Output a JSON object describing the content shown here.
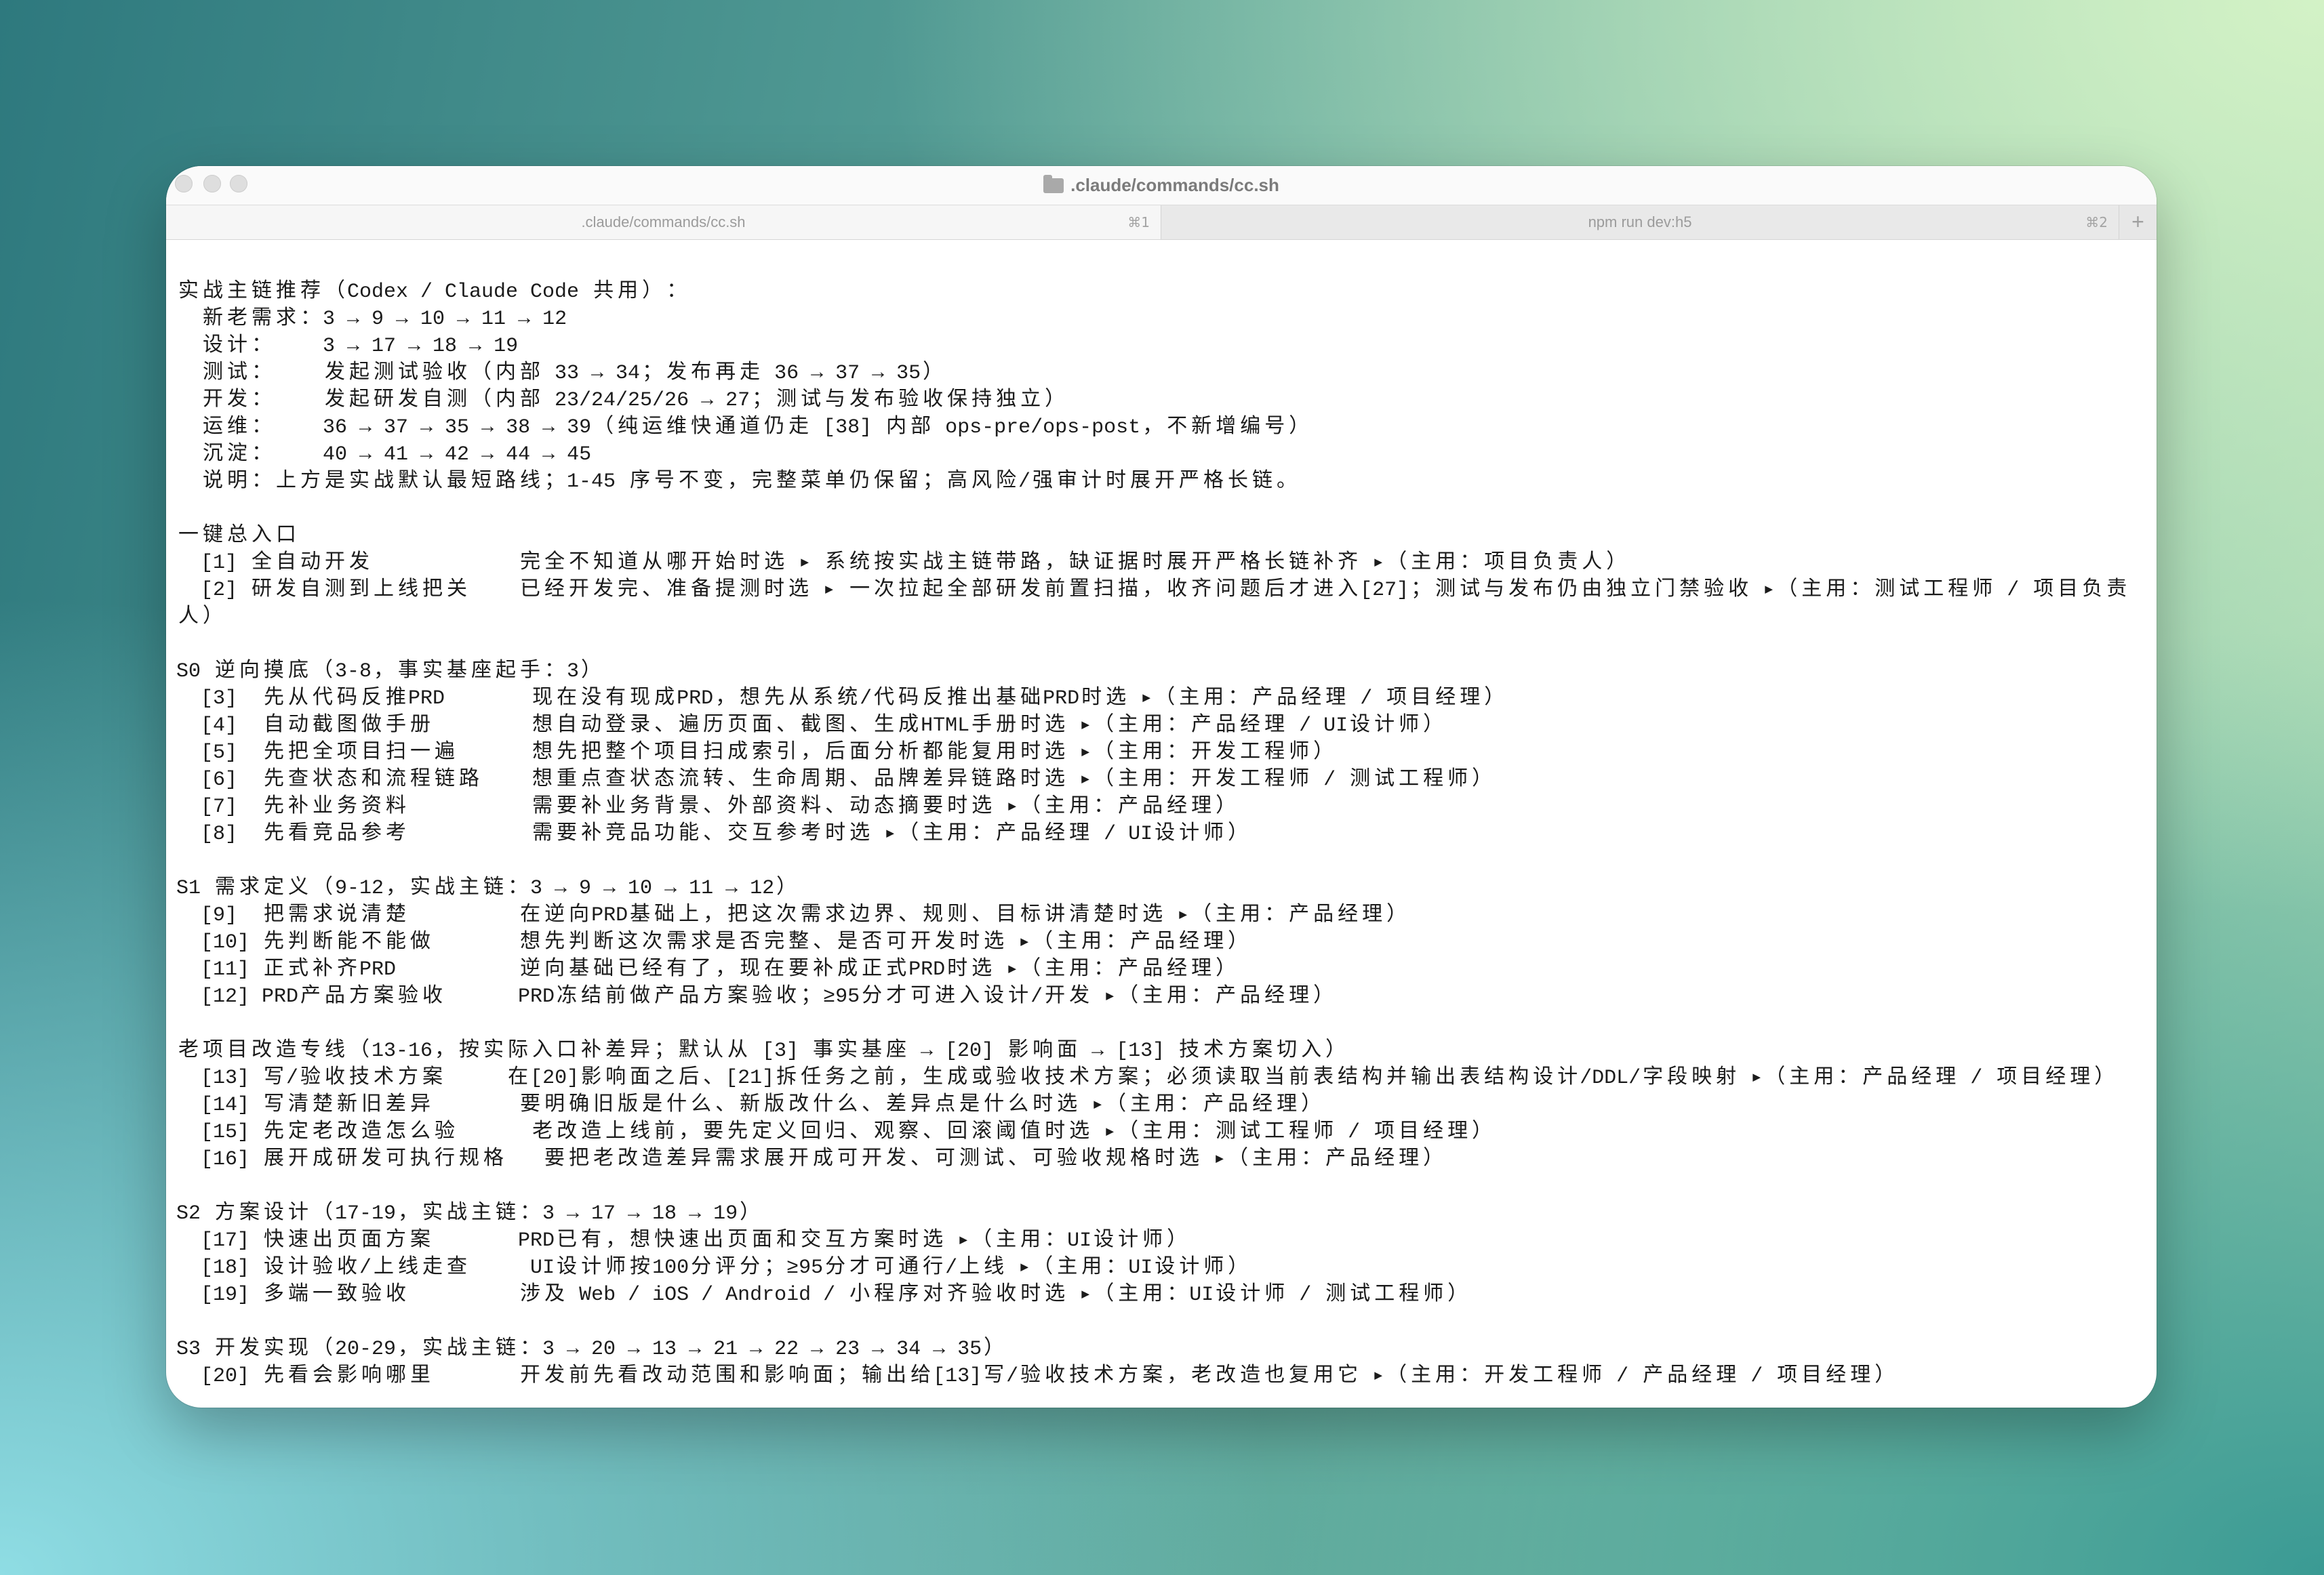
{
  "window": {
    "title": ".claude/commands/cc.sh"
  },
  "tabs": [
    {
      "label": ".claude/commands/cc.sh",
      "shortcut": "⌘1",
      "active": true
    },
    {
      "label": "npm run dev:h5",
      "shortcut": "⌘2",
      "active": false
    }
  ],
  "new_tab": {
    "label": "+"
  },
  "icons": {
    "title": "folder-icon",
    "new_tab": "plus-icon"
  },
  "theme": {
    "terminal_bg": "#ffffff",
    "terminal_text": "#1b1b1b",
    "tab_text": "#9b9b9b"
  },
  "terminal": {
    "lines": [
      "实战主链推荐（Codex / Claude Code 共用）：",
      "  新老需求：3 → 9 → 10 → 11 → 12",
      "  设计：    3 → 17 → 18 → 19",
      "  测试：    发起测试验收（内部 33 → 34；发布再走 36 → 37 → 35）",
      "  开发：    发起研发自测（内部 23/24/25/26 → 27；测试与发布验收保持独立）",
      "  运维：    36 → 37 → 35 → 38 → 39（纯运维快通道仍走 [38] 内部 ops-pre/ops-post，不新增编号）",
      "  沉淀：    40 → 41 → 42 → 44 → 45",
      "  说明：上方是实战默认最短路线；1-45 序号不变，完整菜单仍保留；高风险/强审计时展开严格长链。",
      "",
      "一键总入口",
      "  [1] 全自动开发            完全不知道从哪开始时选 ▸ 系统按实战主链带路，缺证据时展开严格长链补齐 ▸（主用：项目负责人）",
      "  [2] 研发自测到上线把关    已经开发完、准备提测时选 ▸ 一次拉起全部研发前置扫描，收齐问题后才进入[27]；测试与发布仍由独立门禁验收 ▸（主用：测试工程师 / 项目负责",
      "人）",
      "",
      "S0 逆向摸底（3-8，事实基座起手：3）",
      "  [3]  先从代码反推PRD       现在没有现成PRD，想先从系统/代码反推出基础PRD时选 ▸（主用：产品经理 / 项目经理）",
      "  [4]  自动截图做手册        想自动登录、遍历页面、截图、生成HTML手册时选 ▸（主用：产品经理 / UI设计师）",
      "  [5]  先把全项目扫一遍      想先把整个项目扫成索引，后面分析都能复用时选 ▸（主用：开发工程师）",
      "  [6]  先查状态和流程链路    想重点查状态流转、生命周期、品牌差异链路时选 ▸（主用：开发工程师 / 测试工程师）",
      "  [7]  先补业务资料          需要补业务背景、外部资料、动态摘要时选 ▸（主用：产品经理）",
      "  [8]  先看竞品参考          需要补竞品功能、交互参考时选 ▸（主用：产品经理 / UI设计师）",
      "",
      "S1 需求定义（9-12，实战主链：3 → 9 → 10 → 11 → 12）",
      "  [9]  把需求说清楚         在逆向PRD基础上，把这次需求边界、规则、目标讲清楚时选 ▸（主用：产品经理）",
      "  [10] 先判断能不能做       想先判断这次需求是否完整、是否可开发时选 ▸（主用：产品经理）",
      "  [11] 正式补齐PRD          逆向基础已经有了，现在要补成正式PRD时选 ▸（主用：产品经理）",
      "  [12] PRD产品方案验收      PRD冻结前做产品方案验收；≥95分才可进入设计/开发 ▸（主用：产品经理）",
      "",
      "老项目改造专线（13-16，按实际入口补差异；默认从 [3] 事实基座 → [20] 影响面 → [13] 技术方案切入）",
      "  [13] 写/验收技术方案     在[20]影响面之后、[21]拆任务之前，生成或验收技术方案；必须读取当前表结构并输出表结构设计/DDL/字段映射 ▸（主用：产品经理 / 项目经理）",
      "  [14] 写清楚新旧差异       要明确旧版是什么、新版改什么、差异点是什么时选 ▸（主用：产品经理）",
      "  [15] 先定老改造怎么验      老改造上线前，要先定义回归、观察、回滚阈值时选 ▸（主用：测试工程师 / 项目经理）",
      "  [16] 展开成研发可执行规格   要把老改造差异需求展开成可开发、可测试、可验收规格时选 ▸（主用：产品经理）",
      "",
      "S2 方案设计（17-19，实战主链：3 → 17 → 18 → 19）",
      "  [17] 快速出页面方案       PRD已有，想快速出页面和交互方案时选 ▸（主用：UI设计师）",
      "  [18] 设计验收/上线走查     UI设计师按100分评分；≥95分才可通行/上线 ▸（主用：UI设计师）",
      "  [19] 多端一致验收         涉及 Web / iOS / Android / 小程序对齐验收时选 ▸（主用：UI设计师 / 测试工程师）",
      "",
      "S3 开发实现（20-29，实战主链：3 → 20 → 13 → 21 → 22 → 23 → 34 → 35）",
      "  [20] 先看会影响哪里       开发前先看改动范围和影响面；输出给[13]写/验收技术方案，老改造也复用它 ▸（主用：开发工程师 / 产品经理 / 项目经理）"
    ]
  }
}
